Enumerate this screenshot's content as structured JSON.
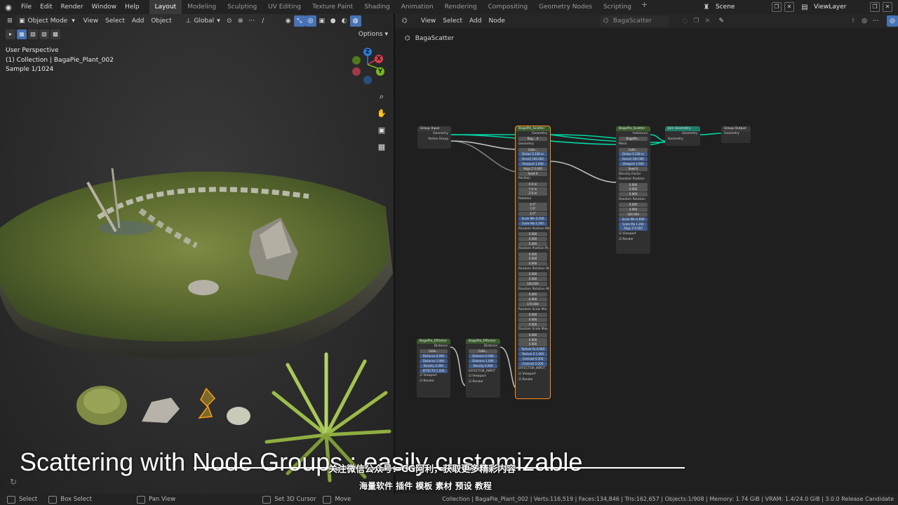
{
  "topbar": {
    "menus": [
      "File",
      "Edit",
      "Render",
      "Window",
      "Help"
    ],
    "workspaces": [
      {
        "label": "Layout",
        "active": true
      },
      {
        "label": "Modeling",
        "active": false
      },
      {
        "label": "Sculpting",
        "active": false
      },
      {
        "label": "UV Editing",
        "active": false
      },
      {
        "label": "Texture Paint",
        "active": false
      },
      {
        "label": "Shading",
        "active": false
      },
      {
        "label": "Animation",
        "active": false
      },
      {
        "label": "Rendering",
        "active": false
      },
      {
        "label": "Compositing",
        "active": false
      },
      {
        "label": "Geometry Nodes",
        "active": false
      },
      {
        "label": "Scripting",
        "active": false
      }
    ],
    "add_workspace": "+",
    "scene": "Scene",
    "view_layer": "ViewLayer"
  },
  "viewport": {
    "mode": "Object Mode",
    "menus": [
      "View",
      "Select",
      "Add",
      "Object"
    ],
    "orientation": "Global",
    "options": "Options",
    "info": {
      "view": "User Perspective",
      "collection": "(1) Collection | BagaPie_Plant_002",
      "sample": "Sample 1/1024"
    },
    "gizmo": {
      "z": "Z",
      "y": "Y",
      "x": "X"
    }
  },
  "node_editor": {
    "menus": [
      "View",
      "Select",
      "Add",
      "Node"
    ],
    "tree_name": "BagaScatter",
    "breadcrumb": "BagaScatter",
    "nodes": {
      "group_input": {
        "title": "Group Input",
        "rows": [
          "Geometry",
          "Vertex Group"
        ]
      },
      "scatter_main": {
        "title": "BagaPie_Scatter",
        "rows": [
          "Geometry",
          "Geometry",
          "Colle...",
          "Distan 0.338 m",
          "Densit 100.000",
          "Viewport 1.000",
          "Align Z 0.000",
          "Seed 0",
          "Position",
          "X 0 m",
          "Y 0 m",
          "Z 0 m",
          "Rotation",
          "X 0°",
          "Y 0°",
          "Z 0°",
          "Scale Min 0.200",
          "Scale Ma 1.200",
          "Random Position Min",
          "0.000",
          "0.000",
          "0.000",
          "Random Position M...",
          "0.000",
          "0.000",
          "0.000",
          "Random Rotation M...",
          "0.000",
          "0.000",
          "100.000",
          "Random Rotation M...",
          "0.000",
          "0.000",
          "170.000",
          "Random Scale Min",
          "0.000",
          "0.000",
          "0.000",
          "Random Scale Max",
          "0.000",
          "0.000",
          "0.000",
          "Texture Fa 0.000",
          "Texture S 1.000",
          "Contrast 0.200",
          "Contrast 0.200",
          "EFFECTOR_INPUT",
          "Viewport",
          "Render"
        ]
      },
      "scatter_second": {
        "title": "BagaPie_Scatter",
        "rows": [
          "Instances",
          "Mesh",
          "Colle...",
          "Distan 0.338 m",
          "Densit 100.000",
          "Viewport 1.000",
          "Seed 0",
          "Density Factor",
          "Random Position",
          "0.000",
          "0.000",
          "0.000",
          "Random Rotation",
          "0.000",
          "0.000",
          "100.000",
          "Scale Min 0.600",
          "Scale Ma 1.200",
          "Align Z 0.000",
          "Viewport",
          "Render"
        ]
      },
      "join": {
        "title": "Join Geometry",
        "rows": [
          "Geometry",
          "Geometry"
        ]
      },
      "group_output": {
        "title": "Group Output",
        "rows": [
          "Geometry"
        ]
      },
      "effector_a": {
        "title": "BagaPie_Effector",
        "rows": [
          "Distance",
          "Colle...",
          "Distance 0.000",
          "Distance 1.000",
          "Density 0.000",
          "EFFECTO 1.000",
          "Viewport",
          "Render"
        ]
      },
      "effector_b": {
        "title": "BagaPie_Effector",
        "rows": [
          "Distance",
          "Colle...",
          "Distance 0.000",
          "Distance 1.000",
          "Density 0.000",
          "EFFECTOR_INPUT",
          "Viewport",
          "Render"
        ]
      }
    }
  },
  "subtitles": {
    "main": "Scattering with Node Groups : easily customizable",
    "cn1": "关注微信公众号：CG阿利，获取更多精彩内容",
    "cn2": "海量软件 插件 模板 素材 预设 教程"
  },
  "statusbar": {
    "items": [
      {
        "label": "Select",
        "icon": "mouse-left-icon"
      },
      {
        "label": "Box Select",
        "icon": "box-select-icon"
      },
      {
        "label": "Pan View",
        "icon": "mouse-middle-icon"
      },
      {
        "label": "Set 3D Cursor",
        "icon": "mouse-right-icon"
      },
      {
        "label": "Move",
        "icon": "move-icon"
      }
    ],
    "stats": "Collection | BagaPie_Plant_002 | Verts:116,519 | Faces:134,846 | Tris:162,657 | Objects:1/908 | Memory: 1.74 GiB | VRAM: 1.4/24.0 GiB | 3.0.0 Release Candidate"
  },
  "colors": {
    "accent": "#4772b3",
    "selected_node": "#ff8c1a",
    "geometry_link": "#00d6a3",
    "topbar": "#232323"
  }
}
